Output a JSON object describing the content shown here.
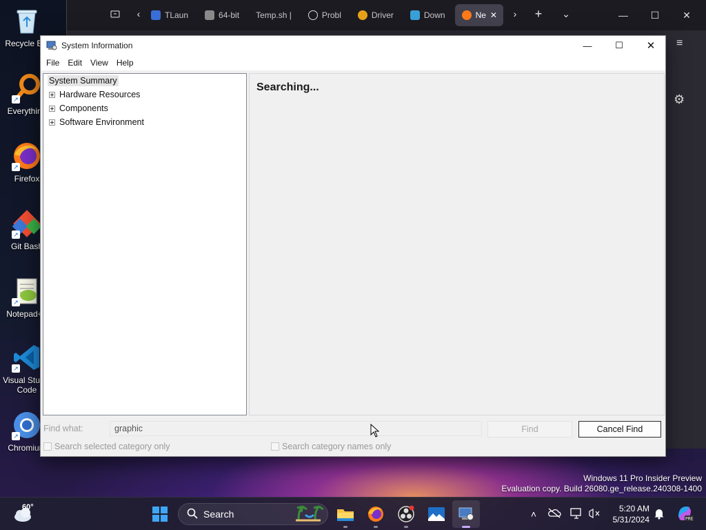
{
  "desktop": {
    "icons": [
      {
        "label": "Recycle Bin",
        "icon": "recycle-bin-icon"
      },
      {
        "label": "Everything",
        "icon": "everything-search-icon"
      },
      {
        "label": "Firefox",
        "icon": "firefox-icon"
      },
      {
        "label": "Git Bash",
        "icon": "git-bash-icon"
      },
      {
        "label": "Notepad++",
        "icon": "notepad-plus-plus-icon"
      },
      {
        "label": "Visual Studio Code",
        "icon": "vscode-icon"
      },
      {
        "label": "Chromium",
        "icon": "chromium-icon"
      }
    ]
  },
  "browser": {
    "tabs": [
      {
        "label": "TLaun",
        "icon": "page-icon"
      },
      {
        "label": "64-bit",
        "icon": "file-icon"
      },
      {
        "label": "Temp.sh |",
        "icon": ""
      },
      {
        "label": "Probl",
        "icon": "info-icon"
      },
      {
        "label": "Driver",
        "icon": "driver-icon"
      },
      {
        "label": "Down",
        "icon": "download-site-icon"
      },
      {
        "label": "Ne",
        "icon": "firefox-icon"
      }
    ]
  },
  "window": {
    "title": "System Information",
    "menu": [
      "File",
      "Edit",
      "View",
      "Help"
    ],
    "tree": {
      "root": "System Summary",
      "children": [
        "Hardware Resources",
        "Components",
        "Software Environment"
      ]
    },
    "status": "Searching...",
    "find": {
      "label": "Find what:",
      "value": "graphic",
      "find_button": "Find",
      "cancel_button": "Cancel Find",
      "checkbox_selected": "Search selected category only",
      "checkbox_names": "Search category names only"
    }
  },
  "watermark": {
    "line1": "Windows 11 Pro Insider Preview",
    "line2": "Evaluation copy. Build 26080.ge_release.240308-1400"
  },
  "taskbar": {
    "weather_temp": "60°",
    "search_placeholder": "Search",
    "time": "5:20 AM",
    "date": "5/31/2024"
  }
}
